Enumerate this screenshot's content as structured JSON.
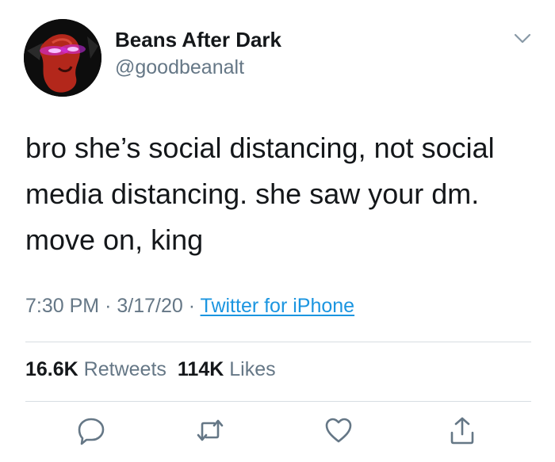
{
  "user": {
    "display_name": "Beans After Dark",
    "handle": "@goodbeanalt"
  },
  "tweet": {
    "text_lines": [
      "bro she’s social distancing, not social",
      "media distancing. she saw your dm.",
      "move on, king"
    ],
    "time": "7:30 PM",
    "date": "3/17/20",
    "separator": "·",
    "source": "Twitter for iPhone"
  },
  "stats": {
    "retweets_count": "16.6K",
    "retweets_label": "Retweets",
    "likes_count": "114K",
    "likes_label": "Likes"
  },
  "icons": {
    "reply": "reply-icon",
    "retweet": "retweet-icon",
    "like": "like-icon",
    "share": "share-icon",
    "more": "chevron-down-icon"
  },
  "colors": {
    "text": "#14171a",
    "secondary": "#657786",
    "link": "#1b95e0",
    "divider": "#d7dde2",
    "avatar_bean": "#b3271b",
    "avatar_eyes": "#d62ef2"
  }
}
